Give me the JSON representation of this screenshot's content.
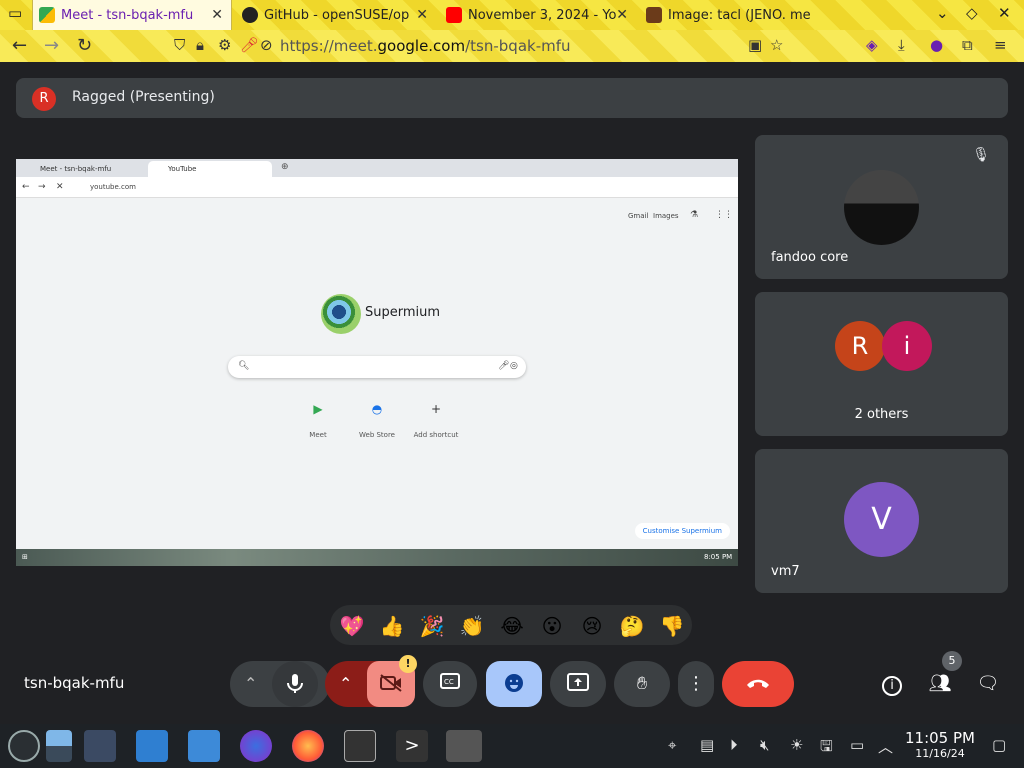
{
  "browser": {
    "tabs": [
      {
        "title": "Meet - tsn-bqak-mfu",
        "active": true
      },
      {
        "title": "GitHub - openSUSE/op"
      },
      {
        "title": "November 3, 2024 - Yo"
      },
      {
        "title": "Image: tacl (JENO. me"
      }
    ],
    "url_prefix": "https://meet.",
    "url_domain": "google.com",
    "url_path": "/tsn-bqak-mfu"
  },
  "meet": {
    "presenter_initial": "R",
    "presenter_label": "Ragged (Presenting)",
    "shared_screen": {
      "tabs": [
        "Meet - tsn-bqak-mfu",
        "YouTube"
      ],
      "url": "youtube.com",
      "top_links": [
        "Gmail",
        "Images"
      ],
      "logo_text": "Supermium",
      "shortcuts": [
        "Meet",
        "Web Store",
        "Add shortcut"
      ],
      "customise_label": "Customise Supermium",
      "clock": "8:05 PM"
    },
    "participants": [
      {
        "name": "fandoo core",
        "muted": true
      },
      {
        "name": "2 others",
        "initials": [
          "R",
          "i"
        ]
      },
      {
        "name": "vm7",
        "initial": "V"
      }
    ],
    "reactions": [
      "💖",
      "👍",
      "🎉",
      "👏",
      "😂",
      "😮",
      "😢",
      "🤔",
      "👎"
    ],
    "meeting_code": "tsn-bqak-mfu",
    "camera_warning": "!",
    "people_count": "5",
    "colors": {
      "end_call": "#ea4335",
      "reactions_active": "#a8c7fa",
      "camera_off": "#f28b82",
      "mic_off_bg": "#8c1d18"
    }
  },
  "os": {
    "time": "11:05 PM",
    "date": "11/16/24"
  }
}
